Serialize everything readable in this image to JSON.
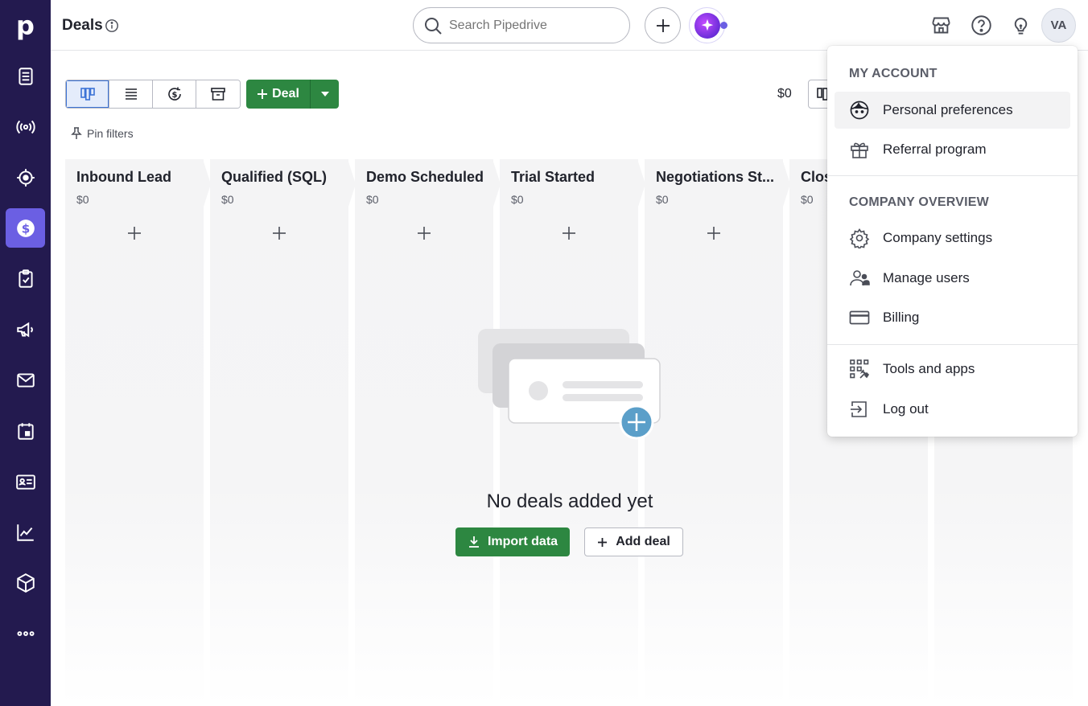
{
  "sidebar": {
    "logo_letter": "p",
    "items": [
      {
        "name": "leads-inbox",
        "icon": "leads-icon"
      },
      {
        "name": "campaigns-radio",
        "icon": "radio-icon"
      },
      {
        "name": "projects-target",
        "icon": "target-icon"
      },
      {
        "name": "deals",
        "icon": "dollar-icon",
        "active": true
      },
      {
        "name": "activities",
        "icon": "clipboard-check-icon"
      },
      {
        "name": "campaigns",
        "icon": "megaphone-icon"
      },
      {
        "name": "mail",
        "icon": "mail-icon"
      },
      {
        "name": "calendar",
        "icon": "calendar-icon"
      },
      {
        "name": "contacts",
        "icon": "contact-card-icon"
      },
      {
        "name": "insights",
        "icon": "chart-icon"
      },
      {
        "name": "products",
        "icon": "box-icon"
      },
      {
        "name": "more",
        "icon": "more-icon"
      }
    ]
  },
  "header": {
    "title": "Deals",
    "search_placeholder": "Search Pipedrive",
    "avatar_initials": "VA"
  },
  "toolbar": {
    "deal_button_label": "Deal",
    "total_value": "$0",
    "pin_filters_label": "Pin filters"
  },
  "columns": [
    {
      "name": "Inbound Lead",
      "sum": "$0"
    },
    {
      "name": "Qualified (SQL)",
      "sum": "$0"
    },
    {
      "name": "Demo Scheduled",
      "sum": "$0"
    },
    {
      "name": "Trial Started",
      "sum": "$0"
    },
    {
      "name": "Negotiations St...",
      "sum": "$0"
    },
    {
      "name": "Clos",
      "sum": "$0"
    }
  ],
  "empty_state": {
    "title": "No deals added yet",
    "import_label": "Import data",
    "add_deal_label": "Add deal"
  },
  "account_menu": {
    "my_account_title": "MY ACCOUNT",
    "personal_preferences": "Personal preferences",
    "referral_program": "Referral program",
    "company_overview_title": "COMPANY OVERVIEW",
    "company_settings": "Company settings",
    "manage_users": "Manage users",
    "billing": "Billing",
    "tools_and_apps": "Tools and apps",
    "log_out": "Log out"
  },
  "colors": {
    "sidebar_bg": "#231a4f",
    "sidebar_active": "#6b5fe3",
    "primary_green": "#2d8741",
    "accent_blue": "#3c73d6"
  }
}
